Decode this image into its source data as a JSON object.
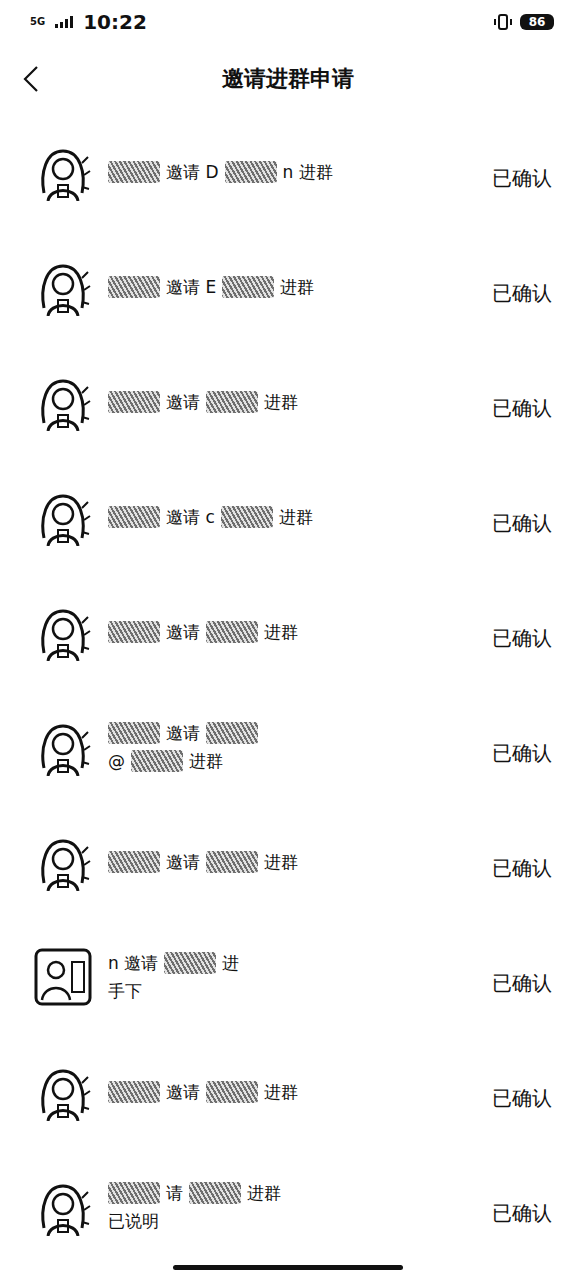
{
  "status_bar": {
    "network": "5G",
    "time": "10:22",
    "battery": "86"
  },
  "header": {
    "title": "邀请进群申请"
  },
  "requests": [
    {
      "avatar": "girl",
      "status": "已确认",
      "lines": [
        [
          {
            "kind": "redacted"
          },
          {
            "kind": "text",
            "text": "邀请 D"
          },
          {
            "kind": "redacted"
          },
          {
            "kind": "text",
            "text": "n 进群"
          }
        ]
      ]
    },
    {
      "avatar": "girl",
      "status": "已确认",
      "lines": [
        [
          {
            "kind": "redacted"
          },
          {
            "kind": "text",
            "text": "邀请 E"
          },
          {
            "kind": "redacted"
          },
          {
            "kind": "text",
            "text": "进群"
          }
        ]
      ]
    },
    {
      "avatar": "girl",
      "status": "已确认",
      "lines": [
        [
          {
            "kind": "redacted"
          },
          {
            "kind": "text",
            "text": "邀请"
          },
          {
            "kind": "redacted"
          },
          {
            "kind": "text",
            "text": "进群"
          }
        ]
      ]
    },
    {
      "avatar": "girl",
      "status": "已确认",
      "lines": [
        [
          {
            "kind": "redacted"
          },
          {
            "kind": "text",
            "text": "邀请 c"
          },
          {
            "kind": "redacted"
          },
          {
            "kind": "text",
            "text": "进群"
          }
        ]
      ]
    },
    {
      "avatar": "girl",
      "status": "已确认",
      "lines": [
        [
          {
            "kind": "redacted"
          },
          {
            "kind": "text",
            "text": "邀请"
          },
          {
            "kind": "redacted"
          },
          {
            "kind": "text",
            "text": "进群"
          }
        ]
      ]
    },
    {
      "avatar": "girl",
      "status": "已确认",
      "lines": [
        [
          {
            "kind": "redacted"
          },
          {
            "kind": "text",
            "text": "邀请"
          },
          {
            "kind": "redacted"
          }
        ],
        [
          {
            "kind": "text",
            "text": "@"
          },
          {
            "kind": "redacted"
          },
          {
            "kind": "text",
            "text": "进群"
          }
        ]
      ]
    },
    {
      "avatar": "girl",
      "status": "已确认",
      "lines": [
        [
          {
            "kind": "redacted"
          },
          {
            "kind": "text",
            "text": "邀请"
          },
          {
            "kind": "redacted"
          },
          {
            "kind": "text",
            "text": "进群"
          }
        ]
      ]
    },
    {
      "avatar": "photo",
      "status": "已确认",
      "lines": [
        [
          {
            "kind": "text",
            "text": "n 邀请"
          },
          {
            "kind": "redacted"
          },
          {
            "kind": "text",
            "text": "进"
          }
        ],
        [
          {
            "kind": "text",
            "text": "手下"
          }
        ]
      ]
    },
    {
      "avatar": "girl",
      "status": "已确认",
      "lines": [
        [
          {
            "kind": "redacted"
          },
          {
            "kind": "text",
            "text": "邀请"
          },
          {
            "kind": "redacted"
          },
          {
            "kind": "text",
            "text": "进群"
          }
        ]
      ]
    },
    {
      "avatar": "girl",
      "status": "已确认",
      "lines": [
        [
          {
            "kind": "redacted"
          },
          {
            "kind": "text",
            "text": "请"
          },
          {
            "kind": "redacted"
          },
          {
            "kind": "text",
            "text": "进群"
          }
        ],
        [
          {
            "kind": "text",
            "text": "已说明"
          }
        ]
      ]
    }
  ]
}
